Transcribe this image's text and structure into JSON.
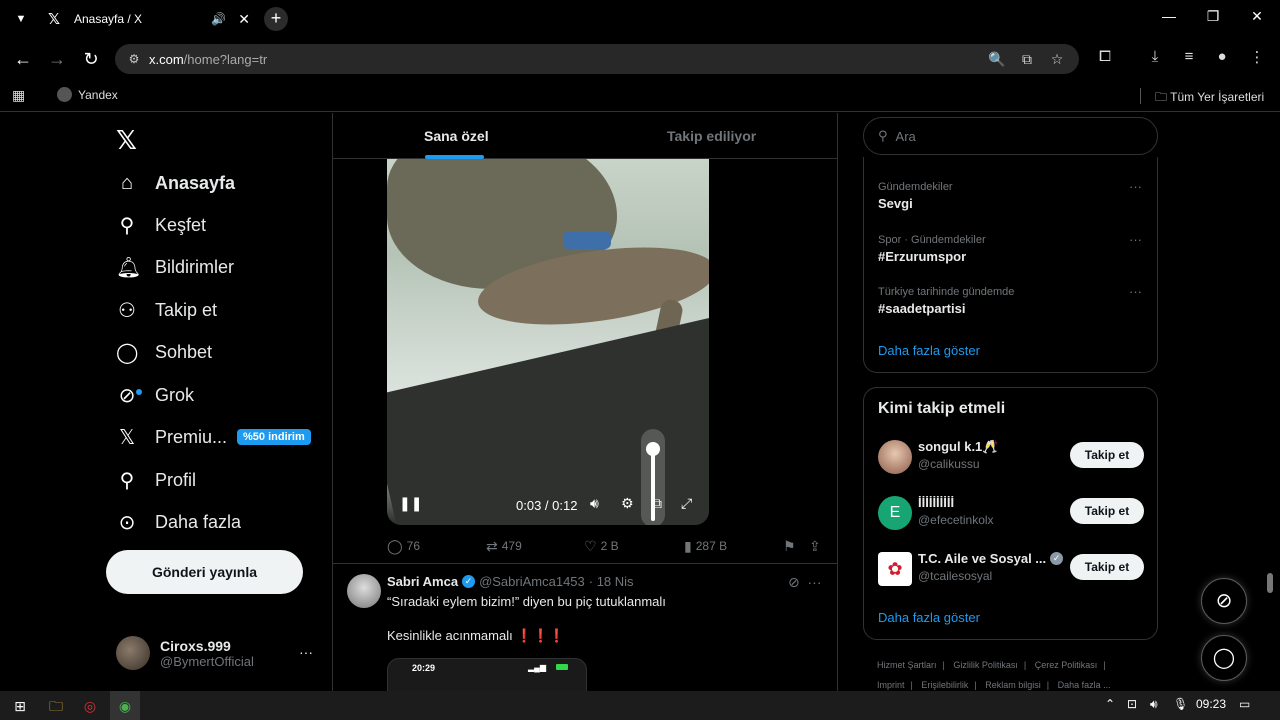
{
  "browser": {
    "tab_title": "Anasayfa / X",
    "url_host": "x.com",
    "url_path": "/home?lang=tr",
    "bookmark_1": "Yandex",
    "all_bookmarks": "Tüm Yer İşaretleri"
  },
  "sidebar": {
    "items": [
      {
        "label": "Anasayfa",
        "icon": "home-icon"
      },
      {
        "label": "Keşfet",
        "icon": "search-icon"
      },
      {
        "label": "Bildirimler",
        "icon": "bell-icon"
      },
      {
        "label": "Takip et",
        "icon": "add-user-icon"
      },
      {
        "label": "Sohbet",
        "icon": "chat-icon"
      },
      {
        "label": "Grok",
        "icon": "grok-icon"
      },
      {
        "label": "Premiu...",
        "icon": "x-icon"
      },
      {
        "label": "Profil",
        "icon": "person-icon"
      },
      {
        "label": "Daha fazla",
        "icon": "more-circle-icon"
      }
    ],
    "premium_badge": "%50 indirim",
    "post_button": "Gönderi yayınla",
    "account": {
      "name": "Ciroxs.999",
      "handle": "@BymertOfficial"
    }
  },
  "feed": {
    "tabs": [
      "Sana özel",
      "Takip ediliyor"
    ],
    "video": {
      "time": "0:03 / 0:12",
      "volume_level": 0.9
    },
    "actions": {
      "replies": "76",
      "reposts": "479",
      "likes": "2 B",
      "views": "287 B"
    },
    "tweet2": {
      "name": "Sabri Amca",
      "handle": "@SabriAmca1453",
      "time": "· 18 Nis",
      "text1": "“Sıradaki eylem bizim!” diyen bu piç tutuklanmalı",
      "text2": "Kesinlikle acınmamalı ❗❗❗",
      "image_time": "20:29"
    }
  },
  "right": {
    "search_placeholder": "Ara",
    "trends": [
      {
        "category": "Gündemdekiler",
        "name": "Sevgi"
      },
      {
        "category": "Spor · Gündemdekiler",
        "name": "#Erzurumspor"
      },
      {
        "category": "Türkiye tarihinde gündemde",
        "name": "#saadetpartisi"
      }
    ],
    "show_more": "Daha fazla göster",
    "who_title": "Kimi takip etmeli",
    "who": [
      {
        "name": "songul k.1🥂",
        "handle": "@calikussu"
      },
      {
        "name": "İİİİİİİİİİ",
        "handle": "@efecetinkolx"
      },
      {
        "name": "T.C. Aile ve Sosyal ...",
        "handle": "@tcailesosyal"
      }
    ],
    "follow_label": "Takip et",
    "footer": [
      "Hizmet Şartları",
      "|",
      "Gizlilik Politikası",
      "|",
      "Çerez Politikası",
      "|",
      "Imprint",
      "|",
      "Erişilebilirlik",
      "|",
      "Reklam bilgisi",
      "|",
      "Daha fazla ..."
    ]
  },
  "taskbar": {
    "clock": "09:23"
  }
}
